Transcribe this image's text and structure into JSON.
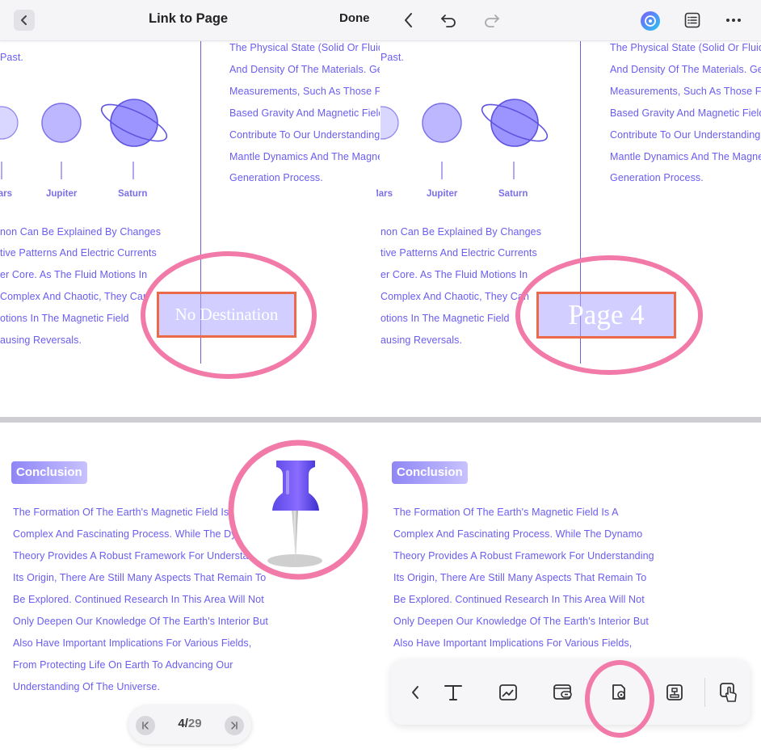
{
  "toolbar": {
    "title": "Link to Page",
    "done_label": "Done"
  },
  "icons": {
    "back": "chevron-left-icon",
    "undo": "undo-icon",
    "redo": "redo-icon",
    "ai": "ai-assistant-icon",
    "outline": "list-icon",
    "more": "more-dots-icon"
  },
  "doc": {
    "left_top_fragment": "Past.",
    "right_top_fragment": "Past.",
    "col2_lines": [
      "The Physical State (Solid Or Fluid",
      "And Density Of The Materials. Ge",
      "Measurements, Such As Those F",
      "Based Gravity And Magnetic Field",
      "Contribute To Our Understanding",
      "Mantle Dynamics And The Magne",
      "Generation Process."
    ],
    "planets": {
      "mars": "Mars",
      "jupiter": "Jupiter",
      "saturn": "Saturn"
    },
    "col1_lines": [
      "non Can Be Explained By Changes",
      "tive Patterns And Electric Currents",
      "er Core. As The Fluid Motions In",
      "Complex And Chaotic, They Can",
      "otions In The Magnetic Field",
      "ausing Reversals."
    ],
    "conclusion_heading": "Conclusion",
    "conclusion_lines": [
      "The Formation Of The Earth's Magnetic Field Is A",
      "Complex And Fascinating Process. While The Dynamo",
      "Theory Provides A Robust Framework For Understanding",
      "Its Origin, There Are Still Many Aspects That Remain To",
      "Be Explored. Continued Research In This Area Will Not",
      "Only Deepen Our Knowledge Of The Earth's Interior But",
      "Also Have Important Implications For Various Fields,",
      "From Protecting Life On Earth To Advancing Our",
      "Understanding Of The Universe."
    ]
  },
  "links": {
    "left_label": "No Destination",
    "right_label": "Page 4"
  },
  "bottom_toolbar": {
    "buttons": [
      "chevron-left-icon",
      "text-tool-icon",
      "image-tool-icon",
      "link-tool-icon",
      "link-page-pin-icon",
      "stamp-tool-icon",
      "hand-pointer-icon"
    ]
  },
  "pager": {
    "current": "4",
    "separator": "/",
    "total": "29"
  },
  "colors": {
    "accent": "#6a5cf0",
    "highlight_ring": "#f27aa8",
    "link_border": "#ea6a4a"
  }
}
